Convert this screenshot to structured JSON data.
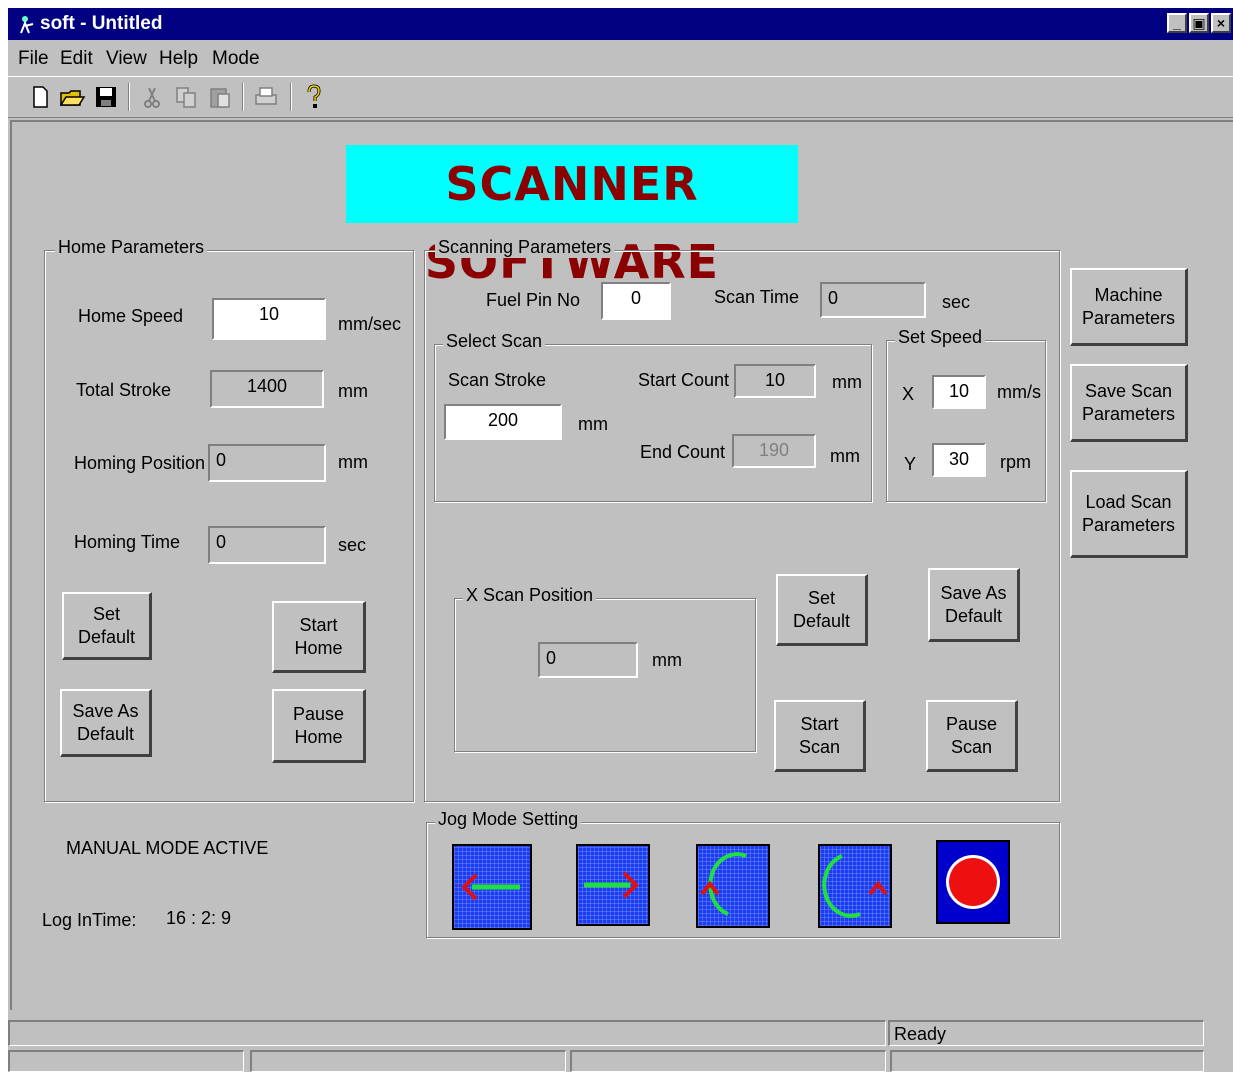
{
  "window": {
    "title": "soft - Untitled"
  },
  "menu": {
    "items": [
      "File",
      "Edit",
      "View",
      "Help",
      "Mode"
    ]
  },
  "toolbar": {
    "icons": [
      "new-icon",
      "open-icon",
      "save-icon",
      "cut-icon",
      "copy-icon",
      "paste-icon",
      "print-icon",
      "help-icon"
    ]
  },
  "banner": {
    "text": "SCANNER SOFTWARE",
    "bg": "#00ffff",
    "fg": "#8b0000"
  },
  "home": {
    "group_label": "Home Parameters",
    "home_speed_label": "Home Speed",
    "home_speed_value": "10",
    "home_speed_unit": "mm/sec",
    "total_stroke_label": "Total Stroke",
    "total_stroke_value": "1400",
    "total_stroke_unit": "mm",
    "homing_position_label": "Homing Position",
    "homing_position_value": "0",
    "homing_position_unit": "mm",
    "homing_time_label": "Homing Time",
    "homing_time_value": "0",
    "homing_time_unit": "sec",
    "set_default": "Set\nDefault",
    "start_home": "Start\nHome",
    "save_as_default": "Save As\nDefault",
    "pause_home": "Pause\nHome"
  },
  "scan": {
    "group_label": "Scanning Parameters",
    "fuel_pin_label": "Fuel Pin No",
    "fuel_pin_value": "0",
    "scan_time_label": "Scan Time",
    "scan_time_value": "0",
    "scan_time_unit": "sec",
    "select_scan_label": "Select Scan",
    "scan_stroke_label": "Scan Stroke",
    "scan_stroke_value": "200",
    "scan_stroke_unit": "mm",
    "start_count_label": "Start Count",
    "start_count_value": "10",
    "start_count_unit": "mm",
    "end_count_label": "End Count",
    "end_count_value": "190",
    "end_count_unit": "mm",
    "set_speed_label": "Set Speed",
    "x_label": "X",
    "x_value": "10",
    "x_unit": "mm/s",
    "y_label": "Y",
    "y_value": "30",
    "y_unit": "rpm",
    "x_scan_position_label": "X Scan Position",
    "x_scan_position_value": "0",
    "x_scan_position_unit": "mm",
    "set_default": "Set\nDefault",
    "save_as_default": "Save As\nDefault",
    "start_scan": "Start\nScan",
    "pause_scan": "Pause\nScan"
  },
  "side": {
    "machine_parameters": "Machine\nParameters",
    "save_scan_parameters": "Save Scan\nParameters",
    "load_scan_parameters": "Load Scan\nParameters"
  },
  "status": {
    "mode": "MANUAL MODE ACTIVE",
    "login_label": "Log InTime:",
    "login_time": "16 : 2: 9",
    "bar_text": "Ready"
  },
  "jog": {
    "group_label": "Jog Mode Setting",
    "buttons": [
      "jog-left-icon",
      "jog-right-icon",
      "rotate-ccw-icon",
      "rotate-cw-icon",
      "stop-icon"
    ]
  }
}
